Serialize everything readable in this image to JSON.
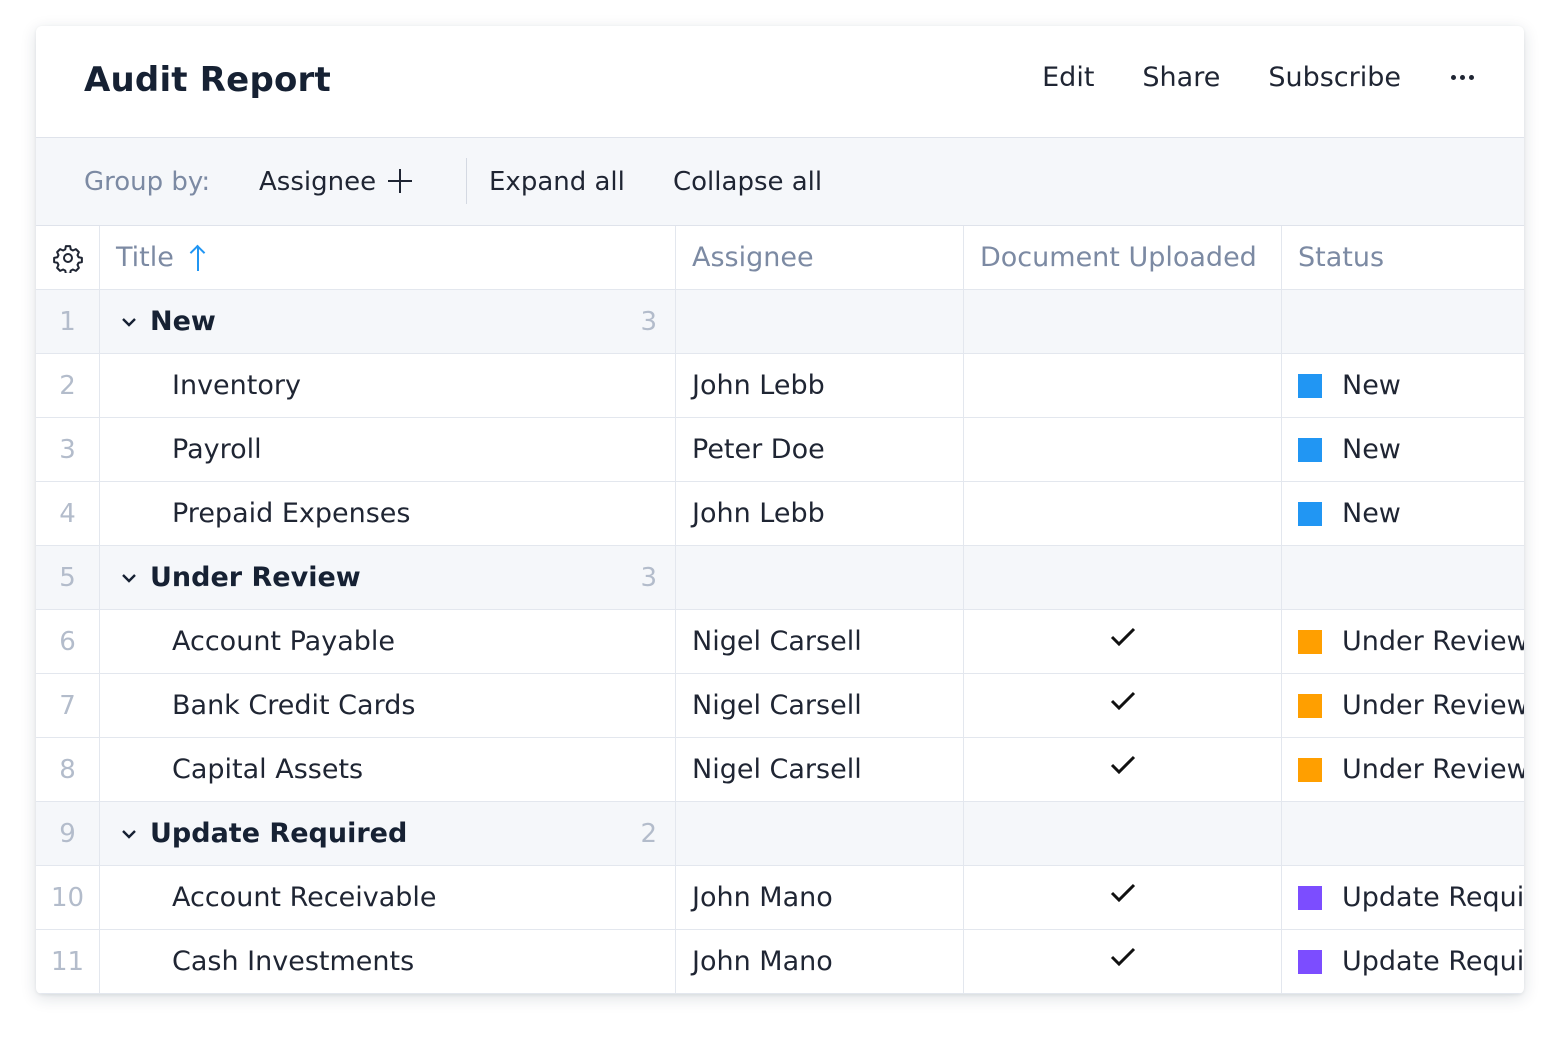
{
  "header": {
    "title": "Audit Report",
    "actions": [
      "Edit",
      "Share",
      "Subscribe"
    ],
    "more_icon": "more-horizontal-icon"
  },
  "toolbar": {
    "group_by_label": "Group by:",
    "group_by_value": "Assignee",
    "add_icon": "plus-icon",
    "expand_all": "Expand all",
    "collapse_all": "Collapse all"
  },
  "columns": {
    "settings_icon": "gear-icon",
    "title": "Title",
    "title_sort": "ascending",
    "assignee": "Assignee",
    "document_uploaded": "Document Uploaded",
    "status": "Status"
  },
  "status_colors": {
    "New": "#2196f3",
    "Under Review": "#ff9f00",
    "Update Required": "#7c4dff"
  },
  "rows": [
    {
      "num": "1",
      "type": "group",
      "title": "New",
      "count": "3"
    },
    {
      "num": "2",
      "type": "item",
      "title": "Inventory",
      "assignee": "John Lebb",
      "uploaded": false,
      "status": "New"
    },
    {
      "num": "3",
      "type": "item",
      "title": "Payroll",
      "assignee": "Peter Doe",
      "uploaded": false,
      "status": "New"
    },
    {
      "num": "4",
      "type": "item",
      "title": "Prepaid Expenses",
      "assignee": "John Lebb",
      "uploaded": false,
      "status": "New"
    },
    {
      "num": "5",
      "type": "group",
      "title": "Under Review",
      "count": "3"
    },
    {
      "num": "6",
      "type": "item",
      "title": "Account Payable",
      "assignee": "Nigel Carsell",
      "uploaded": true,
      "status": "Under Review"
    },
    {
      "num": "7",
      "type": "item",
      "title": "Bank Credit Cards",
      "assignee": "Nigel Carsell",
      "uploaded": true,
      "status": "Under Review"
    },
    {
      "num": "8",
      "type": "item",
      "title": "Capital Assets",
      "assignee": "Nigel Carsell",
      "uploaded": true,
      "status": "Under Review"
    },
    {
      "num": "9",
      "type": "group",
      "title": "Update Required",
      "count": "2"
    },
    {
      "num": "10",
      "type": "item",
      "title": "Account Receivable",
      "assignee": "John Mano",
      "uploaded": true,
      "status": "Update Required"
    },
    {
      "num": "11",
      "type": "item",
      "title": "Cash Investments",
      "assignee": "John Mano",
      "uploaded": true,
      "status": "Update Required"
    }
  ]
}
